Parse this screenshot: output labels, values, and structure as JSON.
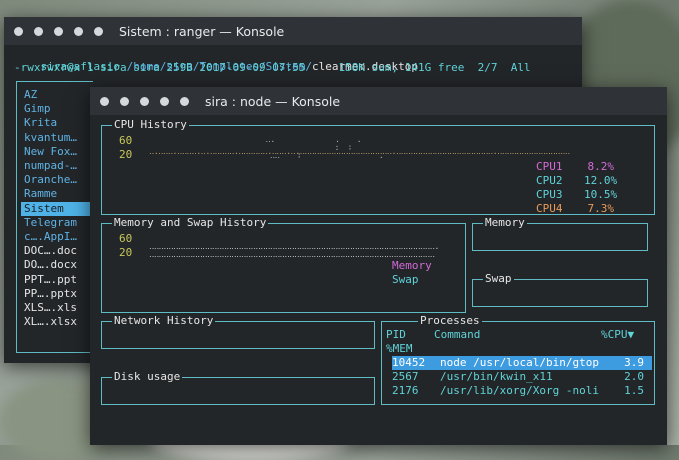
{
  "ranger": {
    "title": "Sistem : ranger — Konsole",
    "path_user": "sira@aflasio",
    "path_dir": " /home/sira/Templates/Sistem/",
    "path_file": "clearmem.desktop",
    "status_line": "-rwxrwxrwx 1 sira sira 259B 2017-09-09 07:55     158K sum, 141G free  2/7  All",
    "files": [
      {
        "name": "AZ",
        "color": "#5fb3e6"
      },
      {
        "name": "Gimp",
        "color": "#5fb3e6"
      },
      {
        "name": "Krita",
        "color": "#5fb3e6"
      },
      {
        "name": "kvantum…",
        "color": "#5fb3e6"
      },
      {
        "name": "New Fox…",
        "color": "#5fb3e6"
      },
      {
        "name": "numpad-…",
        "color": "#5fb3e6"
      },
      {
        "name": "Oranche…",
        "color": "#5fb3e6"
      },
      {
        "name": "Ramme",
        "color": "#5fb3e6"
      },
      {
        "name": "Sistem",
        "color": "#1b1e20",
        "selected": true
      },
      {
        "name": "Telegram",
        "color": "#5fb3e6"
      },
      {
        "name": "c….AppI…",
        "color": "#5fb3e6"
      },
      {
        "name": "DOC….doc",
        "color": "#e6e6e6"
      },
      {
        "name": "DO….docx",
        "color": "#e6e6e6"
      },
      {
        "name": "PPT….ppt",
        "color": "#e6e6e6"
      },
      {
        "name": "PP….pptx",
        "color": "#e6e6e6"
      },
      {
        "name": "XLS….xls",
        "color": "#e6e6e6"
      },
      {
        "name": "XL….xlsx",
        "color": "#e6e6e6"
      }
    ]
  },
  "gtop": {
    "title": "sira : node — Konsole",
    "cpu": {
      "label": "CPU History",
      "y_ticks": [
        "60",
        "20"
      ],
      "legend": [
        {
          "name": "CPU1",
          "value": "8.2%",
          "color": "#d36ad6"
        },
        {
          "name": "CPU2",
          "value": "12.0%",
          "color": "#5fd3d8"
        },
        {
          "name": "CPU3",
          "value": "10.5%",
          "color": "#5fd3d8"
        },
        {
          "name": "CPU4",
          "value": "7.3%",
          "color": "#e89a5a"
        }
      ]
    },
    "mem_history": {
      "label": "Memory and Swap History",
      "y_ticks": [
        "60",
        "20"
      ],
      "legend": [
        {
          "name": "Memory",
          "color": "#d36ad6"
        },
        {
          "name": "Swap",
          "color": "#5fd3d8"
        }
      ]
    },
    "memory": {
      "label": "Memory"
    },
    "swap": {
      "label": "Swap"
    },
    "network": {
      "label": "Network History"
    },
    "disk": {
      "label": "Disk usage"
    },
    "processes": {
      "label": "Processes",
      "header_pid": "PID",
      "header_cmd": "Command",
      "header_cpu": "%CPU▼",
      "header_mem": "%MEM",
      "rows": [
        {
          "pid": "10452",
          "cmd": "node /usr/local/bin/gtop",
          "cpu": "3.9",
          "selected": true
        },
        {
          "pid": "2567",
          "cmd": "/usr/bin/kwin_x11",
          "cpu": "2.0"
        },
        {
          "pid": "2176",
          "cmd": "/usr/lib/xorg/Xorg -noli",
          "cpu": "1.5"
        }
      ]
    }
  }
}
